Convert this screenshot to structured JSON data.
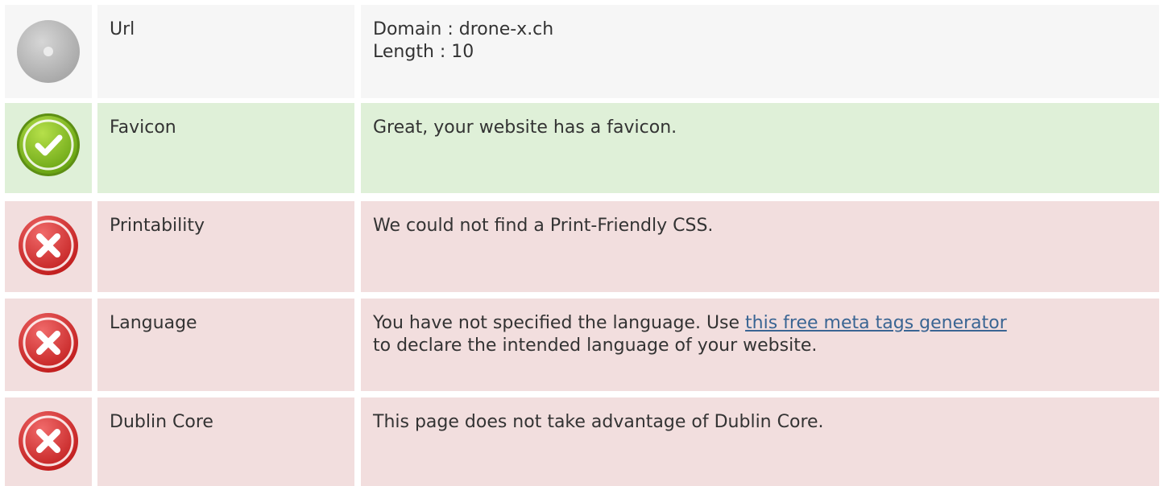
{
  "rows": [
    {
      "status": "neutral",
      "icon": "neutral-circle-icon",
      "label": "Url",
      "lines": [
        "Domain : drone-x.ch",
        "Length : 10"
      ]
    },
    {
      "status": "pass",
      "icon": "check-circle-icon",
      "label": "Favicon",
      "text": "Great, your website has a favicon."
    },
    {
      "status": "fail",
      "icon": "error-circle-icon",
      "label": "Printability",
      "text": "We could not find a Print-Friendly CSS."
    },
    {
      "status": "fail",
      "icon": "error-circle-icon",
      "label": "Language",
      "text_before": "You have not specified the language. Use ",
      "link_text": "this free meta tags generator",
      "text_after": "to declare the intended language of your website."
    },
    {
      "status": "fail",
      "icon": "error-circle-icon",
      "label": "Dublin Core",
      "text": "This page does not take advantage of Dublin Core."
    }
  ],
  "colors": {
    "neutral_bg": "#f6f6f6",
    "pass_bg": "#dff0d8",
    "fail_bg": "#f2dede",
    "link": "#3a6593",
    "text": "#333333"
  }
}
